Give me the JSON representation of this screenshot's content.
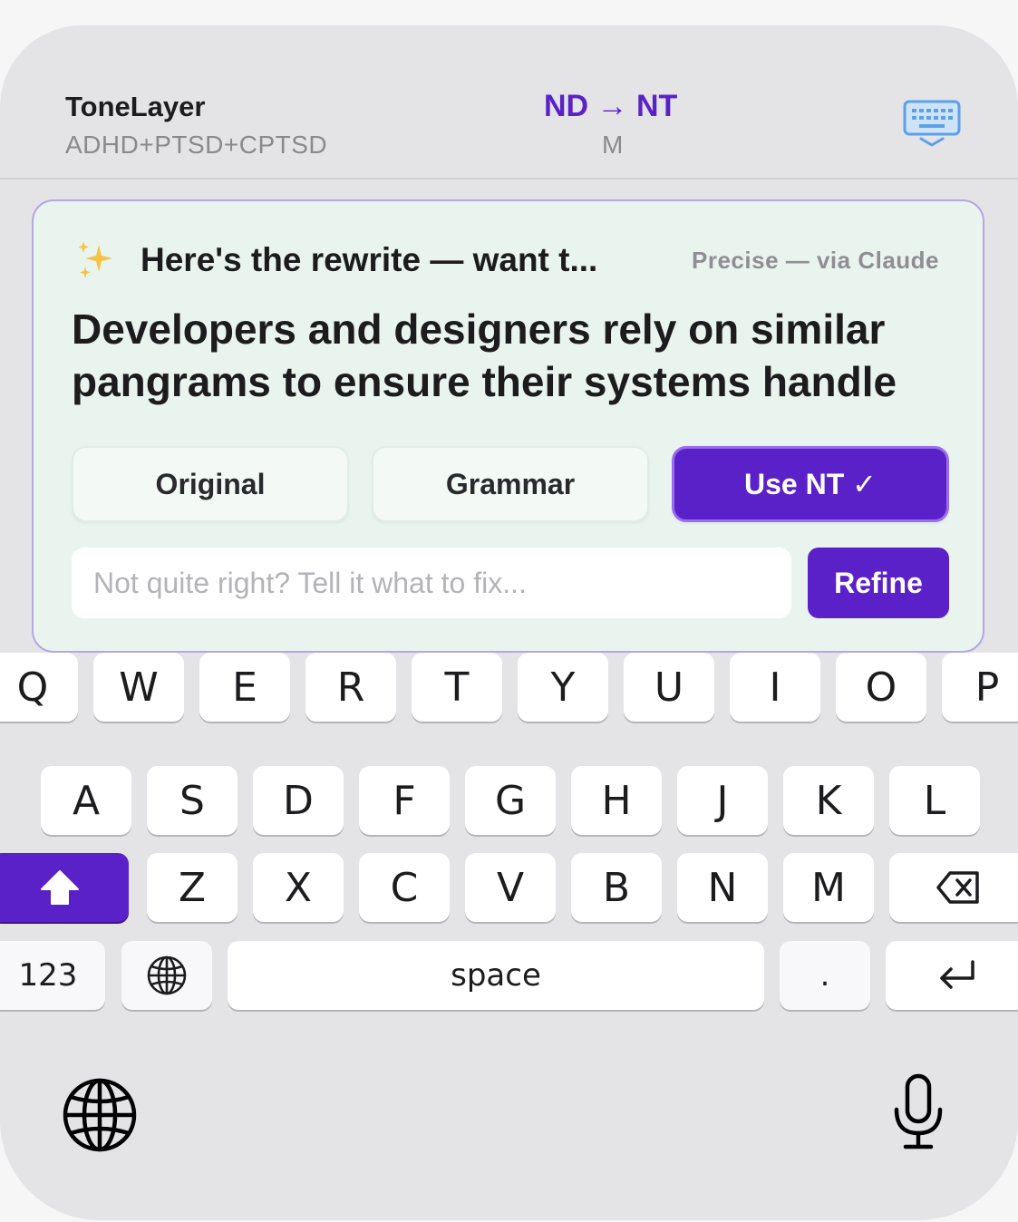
{
  "header": {
    "app_name": "ToneLayer",
    "profile": "ADHD+PTSD+CPTSD",
    "mode": "ND → NT",
    "mode_sub": "M"
  },
  "suggestion": {
    "title": "Here's the rewrite — want t...",
    "meta": "Precise — via Claude",
    "rewrite_text": "Developers and designers rely on similar pangrams to ensure their systems handle",
    "buttons": {
      "original": "Original",
      "grammar": "Grammar",
      "use_nt": "Use NT ✓"
    },
    "fix_placeholder": "Not quite right? Tell it what to fix...",
    "refine_label": "Refine"
  },
  "keyboard": {
    "row1": [
      "Q",
      "W",
      "E",
      "R",
      "T",
      "Y",
      "U",
      "I",
      "O",
      "P"
    ],
    "row2": [
      "A",
      "S",
      "D",
      "F",
      "G",
      "H",
      "J",
      "K",
      "L"
    ],
    "row3": [
      "Z",
      "X",
      "C",
      "V",
      "B",
      "N",
      "M"
    ],
    "numbers_label": "123",
    "space_label": "space",
    "period_label": ".",
    "icons": {
      "shift": "shift-icon",
      "backspace": "backspace-icon",
      "globe": "globe-icon",
      "return": "return-icon",
      "mic": "microphone-icon",
      "keyboard": "keyboard-icon",
      "sparkle": "sparkles-icon"
    }
  },
  "colors": {
    "accent": "#5b21c8",
    "card_bg": "#eaf4ef",
    "card_border": "#b5a6e6",
    "keyboard_bg": "#e4e4e7"
  }
}
